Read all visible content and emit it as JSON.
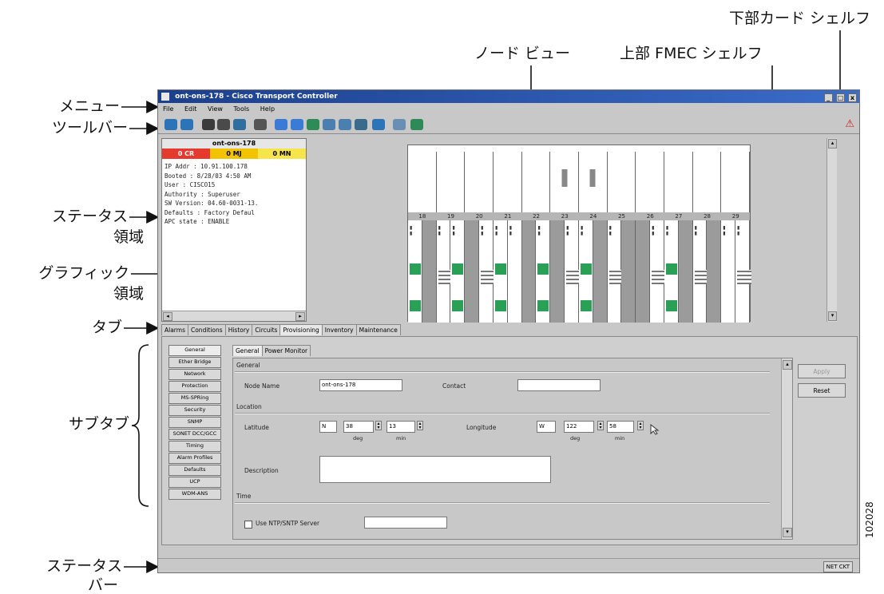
{
  "annotations": {
    "menu": "メニュー",
    "toolbar": "ツールバー",
    "status_area_1": "ステータス",
    "status_area_2": "領域",
    "graphic_area_1": "グラフィック",
    "graphic_area_2": "領域",
    "tabs": "タブ",
    "subtabs": "サブタブ",
    "status_bar_1": "ステータス",
    "status_bar_2": "バー",
    "node_view": "ノード ビュー",
    "upper_fmec_shelf": "上部 FMEC シェルフ",
    "lower_card_shelf": "下部カード シェルフ"
  },
  "figure_id": "102028",
  "window": {
    "title": "ont-ons-178 - Cisco Transport Controller",
    "buttons": [
      "_",
      "□",
      "x"
    ]
  },
  "menu": [
    "File",
    "Edit",
    "View",
    "Tools",
    "Help"
  ],
  "toolbar": {
    "icons": [
      "back-globe-icon",
      "forward-globe-icon",
      "lock-icon",
      "print-icon",
      "export-icon",
      "copy-icon",
      "back-arrow-icon",
      "forward-arrow-icon",
      "up-arrow-icon",
      "home-icon",
      "network-icon",
      "fit-icon",
      "globe-icon",
      "tools-icon",
      "help-icon"
    ],
    "alert_glyph": "⚠",
    "colors": [
      "#2d73b8",
      "#2d73b8",
      "#3b3b3b",
      "#4a4a4a",
      "#2f6f9f",
      "#555555",
      "#3a7bd5",
      "#3a7bd5",
      "#2e8b57",
      "#4a7fb0",
      "#4a7fb0",
      "#3a6b8a",
      "#2d73b8",
      "#6a8fb5",
      "#2e8b57"
    ],
    "alert_color": "#c8201d"
  },
  "status": {
    "node": "ont-ons-178",
    "cr": "0 CR",
    "mj": "0 MJ",
    "mn": "0 MN",
    "lines": [
      "IP Addr    : 10.91.100.178",
      "Booted     : 8/28/03 4:50 AM",
      "User       : CISCO15",
      "Authority  : Superuser",
      "SW Version: 04.60-0031-13.",
      "Defaults   : Factory Defaul",
      "APC state  : ENABLE"
    ],
    "colors": {
      "critical": "#e63a2e",
      "major": "#f2c300",
      "minor": "#f5e54a"
    }
  },
  "shelf": {
    "slot_numbers": [
      "18",
      "19",
      "20",
      "21",
      "22",
      "23",
      "24",
      "25",
      "26",
      "27",
      "28",
      "29"
    ]
  },
  "tabs": [
    "Alarms",
    "Conditions",
    "History",
    "Circuits",
    "Provisioning",
    "Inventory",
    "Maintenance"
  ],
  "subtabs": [
    "General",
    "Ether Bridge",
    "Network",
    "Protection",
    "MS-SPRing",
    "Security",
    "SNMP",
    "SONET DCC/GCC",
    "Timing",
    "Alarm Profiles",
    "Defaults",
    "UCP",
    "WDM-ANS"
  ],
  "inner_tabs": [
    "General",
    "Power Monitor"
  ],
  "form": {
    "general_label": "General",
    "node_name_label": "Node Name",
    "node_name": "ont-ons-178",
    "contact_label": "Contact",
    "contact": "",
    "location_label": "Location",
    "latitude_label": "Latitude",
    "lat_dir": "N",
    "lat_deg": "38",
    "lat_min": "13",
    "longitude_label": "Longitude",
    "lon_dir": "W",
    "lon_deg": "122",
    "lon_min": "58",
    "deg_label": "deg",
    "min_label": "min",
    "description_label": "Description",
    "time_label": "Time",
    "ntp_label": "Use NTP/SNTP Server",
    "apply": "Apply",
    "reset": "Reset"
  },
  "statusbar": {
    "net": "NET",
    "ckt": "CKT"
  }
}
